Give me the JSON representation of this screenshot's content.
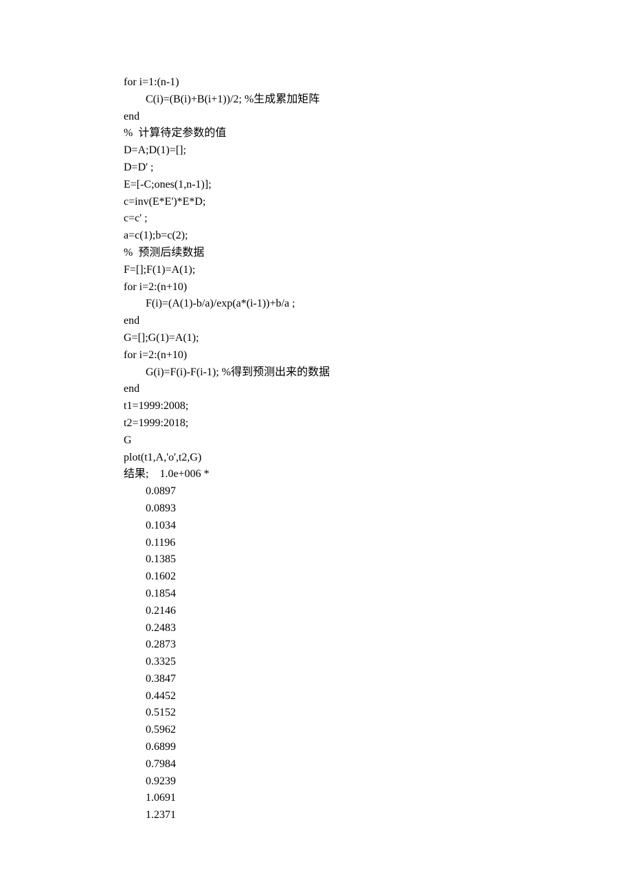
{
  "lines": [
    "for i=1:(n-1)",
    "        C(i)=(B(i)+B(i+1))/2; %生成累加矩阵",
    "end",
    "%  计算待定参数的值",
    "D=A;D(1)=[];",
    "D=D' ;",
    "E=[-C;ones(1,n-1)];",
    "c=inv(E*E')*E*D;",
    "c=c' ;",
    "a=c(1);b=c(2);",
    "%  预测后续数据",
    "F=[];F(1)=A(1);",
    "for i=2:(n+10)",
    "        F(i)=(A(1)-b/a)/exp(a*(i-1))+b/a ;",
    "end",
    "G=[];G(1)=A(1);",
    "for i=2:(n+10)",
    "        G(i)=F(i)-F(i-1); %得到预测出来的数据",
    "end",
    "t1=1999:2008;",
    "t2=1999:2018;",
    "G",
    "plot(t1,A,'o',t2,G)",
    "结果;    1.0e+006 *",
    "        0.0897",
    "        0.0893",
    "        0.1034",
    "        0.1196",
    "        0.1385",
    "        0.1602",
    "        0.1854",
    "        0.2146",
    "        0.2483",
    "        0.2873",
    "        0.3325",
    "        0.3847",
    "        0.4452",
    "        0.5152",
    "        0.5962",
    "        0.6899",
    "        0.7984",
    "        0.9239",
    "        1.0691",
    "        1.2371"
  ]
}
